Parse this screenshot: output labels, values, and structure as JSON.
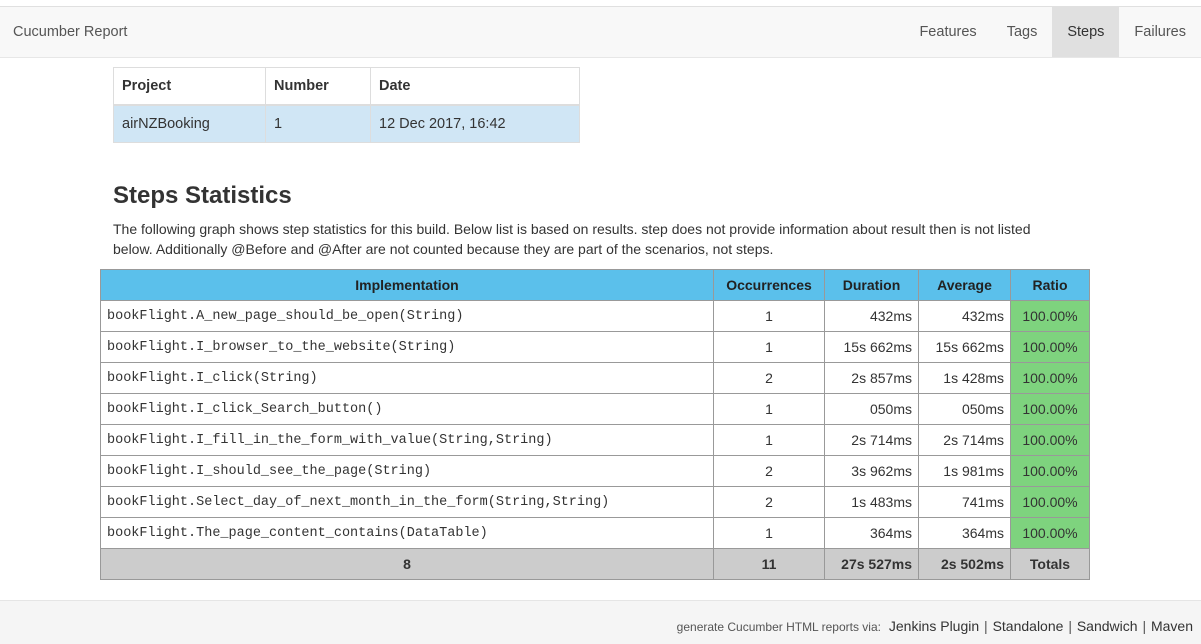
{
  "navbar": {
    "brand": "Cucumber Report",
    "items": [
      {
        "label": "Features",
        "active": false
      },
      {
        "label": "Tags",
        "active": false
      },
      {
        "label": "Steps",
        "active": true
      },
      {
        "label": "Failures",
        "active": false
      }
    ]
  },
  "project_table": {
    "headers": [
      "Project",
      "Number",
      "Date"
    ],
    "row": [
      "airNZBooking",
      "1",
      "12 Dec 2017, 16:42"
    ]
  },
  "steps_section": {
    "title": "Steps Statistics",
    "description": "The following graph shows step statistics for this build. Below list is based on results. step does not provide information about result then is not listed below. Additionally @Before and @After are not counted because they are part of the scenarios, not steps."
  },
  "steps_table": {
    "headers": [
      "Implementation",
      "Occurrences",
      "Duration",
      "Average",
      "Ratio"
    ],
    "rows": [
      [
        "bookFlight.A_new_page_should_be_open(String)",
        "1",
        "432ms",
        "432ms",
        "100.00%"
      ],
      [
        "bookFlight.I_browser_to_the_website(String)",
        "1",
        "15s 662ms",
        "15s 662ms",
        "100.00%"
      ],
      [
        "bookFlight.I_click(String)",
        "2",
        "2s 857ms",
        "1s 428ms",
        "100.00%"
      ],
      [
        "bookFlight.I_click_Search_button()",
        "1",
        "050ms",
        "050ms",
        "100.00%"
      ],
      [
        "bookFlight.I_fill_in_the_form_with_value(String,String)",
        "1",
        "2s 714ms",
        "2s 714ms",
        "100.00%"
      ],
      [
        "bookFlight.I_should_see_the_page(String)",
        "2",
        "3s 962ms",
        "1s 981ms",
        "100.00%"
      ],
      [
        "bookFlight.Select_day_of_next_month_in_the_form(String,String)",
        "2",
        "1s 483ms",
        "741ms",
        "100.00%"
      ],
      [
        "bookFlight.The_page_content_contains(DataTable)",
        "1",
        "364ms",
        "364ms",
        "100.00%"
      ]
    ],
    "totals": [
      "8",
      "11",
      "27s 527ms",
      "2s 502ms",
      "Totals"
    ]
  },
  "footer": {
    "prefix": "generate Cucumber HTML reports via:",
    "links": [
      "Jenkins Plugin",
      "Standalone",
      "Sandwich",
      "Maven"
    ],
    "separator": "|"
  },
  "colors": {
    "header_blue": "#5bc0eb",
    "passed_green": "#7ed37e",
    "project_row_blue": "#d0e6f5",
    "totals_gray": "#cccccc"
  }
}
